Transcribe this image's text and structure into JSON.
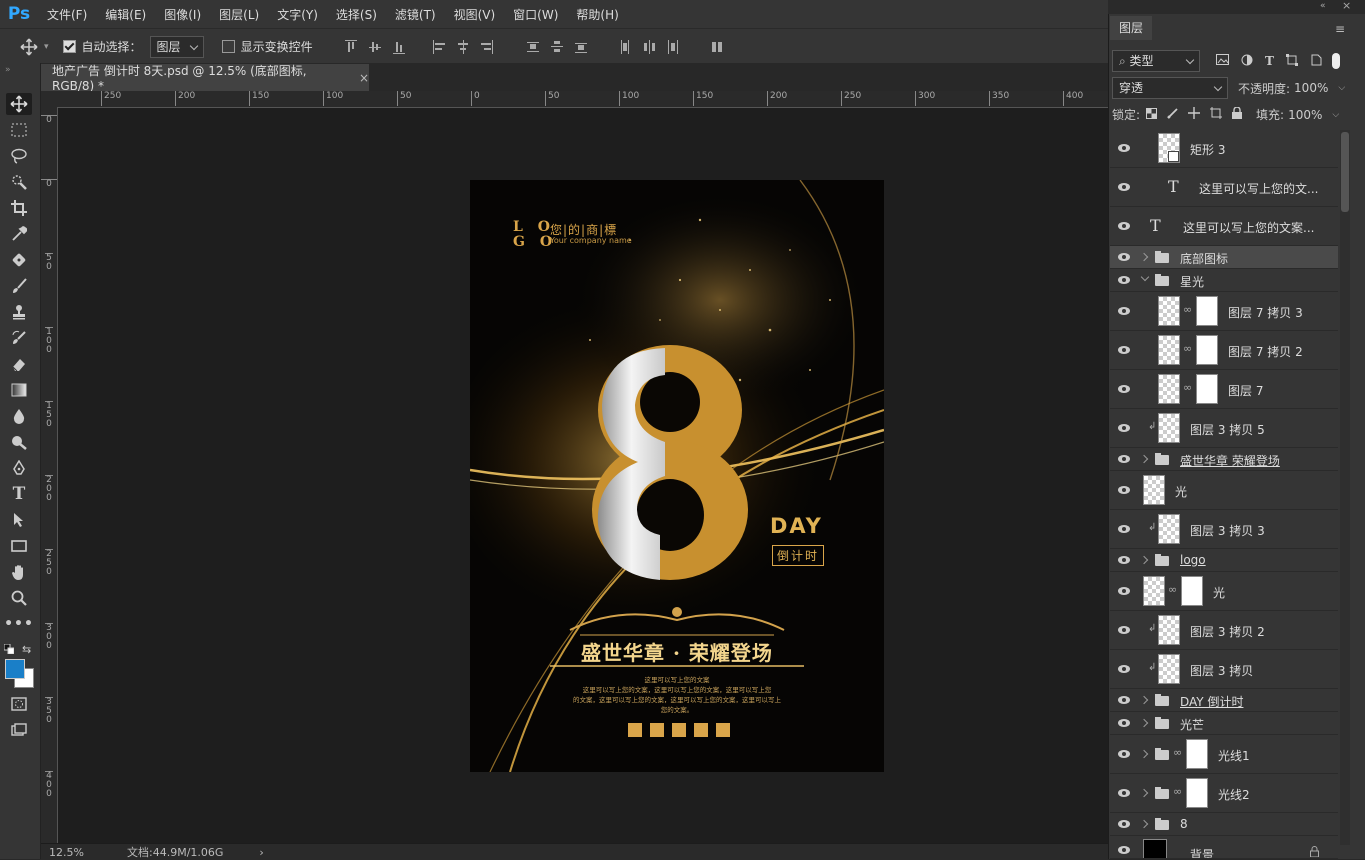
{
  "app": {
    "logo": "Ps"
  },
  "menu": [
    "文件(F)",
    "编辑(E)",
    "图像(I)",
    "图层(L)",
    "文字(Y)",
    "选择(S)",
    "滤镜(T)",
    "视图(V)",
    "窗口(W)",
    "帮助(H)"
  ],
  "options": {
    "auto_select_label": "自动选择：",
    "auto_select_value": "图层",
    "show_transform_label": "显示变换控件"
  },
  "document": {
    "tab_title": "地产广告 倒计时 8天.psd @ 12.5% (底部图标, RGB/8) *",
    "close": "×"
  },
  "ruler_top": [
    "250",
    "200",
    "150",
    "100",
    "50",
    "0",
    "50",
    "100",
    "150",
    "200",
    "250",
    "300",
    "350",
    "400"
  ],
  "ruler_left": [
    "0",
    "0",
    "5 0",
    "1 0 0",
    "1 5 0",
    "2 0 0",
    "2 5 0",
    "3 0 0",
    "3 5 0",
    "4 0 0"
  ],
  "status": {
    "zoom": "12.5%",
    "doc": "文档:44.9M/1.06G",
    "arrow": "›"
  },
  "poster": {
    "logo": "L O\nG O",
    "brand_cn": "您|的|商|標",
    "brand_en": "Your company name",
    "big_number": "8",
    "day": "DAY",
    "countdown": "倒计时",
    "headline": "盛世华章 · 荣耀登场",
    "body_lines": [
      "这里可以写上您的文案",
      "这里可以写上您的文案，这里可以写上您的文案，这里可以写上您",
      "的文案，这里可以写上您的文案，这里可以写上您的文案，这里可以写上",
      "您的文案。"
    ]
  },
  "panel": {
    "tab": "图层",
    "kind_label": "类型",
    "blend_mode": "穿透",
    "opacity_label": "不透明度:",
    "opacity_value": "100%",
    "lock_label": "锁定:",
    "fill_label": "填充:",
    "fill_value": "100%",
    "layers": [
      {
        "name": "矩形 3",
        "kind": "shape"
      },
      {
        "name": "这里可以写上您的文...",
        "kind": "text"
      },
      {
        "name": "这里可以写上您的文案...",
        "kind": "text"
      },
      {
        "name": "底部图标",
        "kind": "group"
      },
      {
        "name": "星光",
        "kind": "group-open"
      },
      {
        "name": "图层 7 拷贝 3",
        "kind": "masked"
      },
      {
        "name": "图层 7 拷贝 2",
        "kind": "masked"
      },
      {
        "name": "图层 7",
        "kind": "masked"
      },
      {
        "name": "图层 3 拷贝 5",
        "kind": "clipped"
      },
      {
        "name": "盛世华章 荣耀登场",
        "kind": "group"
      },
      {
        "name": "光",
        "kind": "pixel"
      },
      {
        "name": "图层 3 拷贝 3",
        "kind": "clipped"
      },
      {
        "name": "logo",
        "kind": "group"
      },
      {
        "name": "光",
        "kind": "masked"
      },
      {
        "name": "图层 3 拷贝 2",
        "kind": "clipped"
      },
      {
        "name": "图层 3 拷贝",
        "kind": "clipped"
      },
      {
        "name": "DAY 倒计时",
        "kind": "group"
      },
      {
        "name": "光芒",
        "kind": "group"
      },
      {
        "name": "光线1",
        "kind": "group-mask"
      },
      {
        "name": "光线2",
        "kind": "group-mask"
      },
      {
        "name": "8",
        "kind": "group"
      },
      {
        "name": "背景",
        "kind": "background"
      }
    ]
  },
  "colors": {
    "foreground": "#1a7fc8",
    "background": "#ffffff",
    "accent": "#31a8ff",
    "gold": "#d9a54a"
  }
}
